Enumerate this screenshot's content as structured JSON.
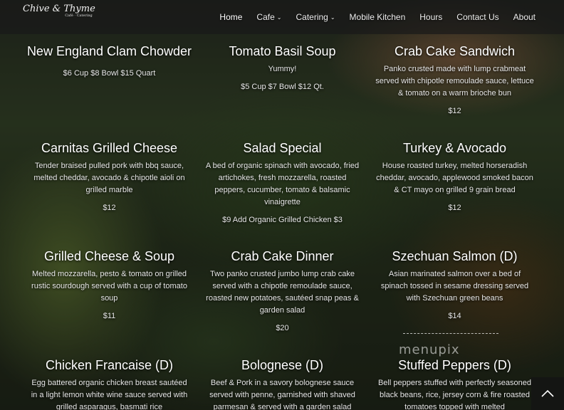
{
  "brand": {
    "name": "Chive & Thyme",
    "tagline": "Café · Catering"
  },
  "nav": {
    "home": "Home",
    "cafe": "Cafe",
    "catering": "Catering",
    "mobile_kitchen": "Mobile Kitchen",
    "hours": "Hours",
    "contact": "Contact Us",
    "about": "About"
  },
  "menu": [
    {
      "title": "New England Clam Chowder",
      "desc": "",
      "price": "$6 Cup $8 Bowl $15 Quart"
    },
    {
      "title": "Tomato Basil Soup",
      "desc": "Yummy!",
      "price": "$5 Cup $7 Bowl $12 Qt."
    },
    {
      "title": "Crab Cake Sandwich",
      "desc": "Panko crusted made with lump crabmeat served with chipotle remoulade sauce, lettuce & tomato on a warm brioche bun",
      "price": "$12"
    },
    {
      "title": "Carnitas Grilled Cheese",
      "desc": "Tender braised pulled pork with bbq sauce, melted cheddar, avocado & chipotle aioli on grilled marble",
      "price": "$12"
    },
    {
      "title": "Salad Special",
      "desc": "A bed of organic spinach with avocado, fried artichokes, fresh mozzarella, roasted peppers, cucumber, tomato & balsamic vinaigrette",
      "price": "$9 Add Organic Grilled Chicken $3"
    },
    {
      "title": "Turkey & Avocado",
      "desc": "House roasted turkey, melted horseradish cheddar, avocado, applewood smoked bacon & CT mayo on grilled 9 grain bread",
      "price": "$12"
    },
    {
      "title": "Grilled Cheese & Soup",
      "desc": "Melted mozzarella, pesto & tomato on grilled rustic sourdough served with a cup of tomato soup",
      "price": "$11"
    },
    {
      "title": "Crab Cake Dinner",
      "desc": "Two panko crusted jumbo lump crab cake served with a chipotle remoulade sauce, roasted new potatoes, sautéed snap peas & garden salad",
      "price": "$20"
    },
    {
      "title": "Szechuan Salmon (D)",
      "desc": "Asian marinated salmon over a bed of spinach tossed in sesame dressing served with Szechuan green beans",
      "price": "$14"
    },
    {
      "title": "Chicken Francaise (D)",
      "desc": "Egg battered organic chicken breast sautéed in a light lemon white wine sauce served with grilled asparagus, basmati rice",
      "price": ""
    },
    {
      "title": "Bolognese (D)",
      "desc": "Beef & Pork in a savory bolognese sauce served with penne, garnished with shaved parmesan & served with a garden salad",
      "price": ""
    },
    {
      "title": "Stuffed Peppers (D)",
      "desc": "Bell peppers stuffed with perfectly seasoned black beans, rice, jersey corn & fire roasted tomatoes topped with melted",
      "price": ""
    }
  ],
  "watermark": "menupix"
}
